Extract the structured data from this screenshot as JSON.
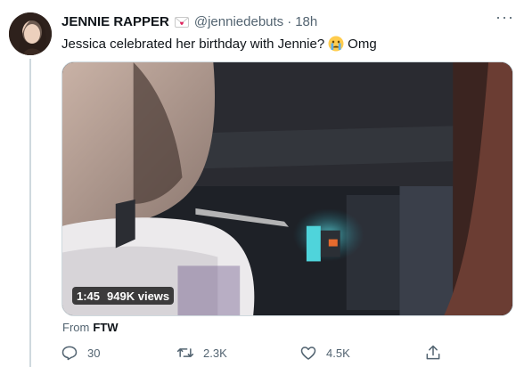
{
  "tweet": {
    "display_name": "JENNIE RAPPER",
    "handle": "@jenniedebuts",
    "separator": "·",
    "time": "18h",
    "text_before": "Jessica celebrated her birthday with Jennie?",
    "text_after": "Omg",
    "more_label": "···"
  },
  "media": {
    "duration": "1:45",
    "views": "949K views"
  },
  "source": {
    "prefix": "From",
    "name": "FTW"
  },
  "actions": {
    "replies": "30",
    "retweets": "2.3K",
    "likes": "4.5K"
  },
  "icons": {
    "name_emoji": "love-letter-icon",
    "text_emoji": "crying-face-icon",
    "reply": "reply-icon",
    "retweet": "retweet-icon",
    "like": "heart-icon",
    "share": "share-icon",
    "more": "more-icon"
  },
  "colors": {
    "text": "#0f1419",
    "muted": "#536471",
    "border": "#cfd9de"
  }
}
